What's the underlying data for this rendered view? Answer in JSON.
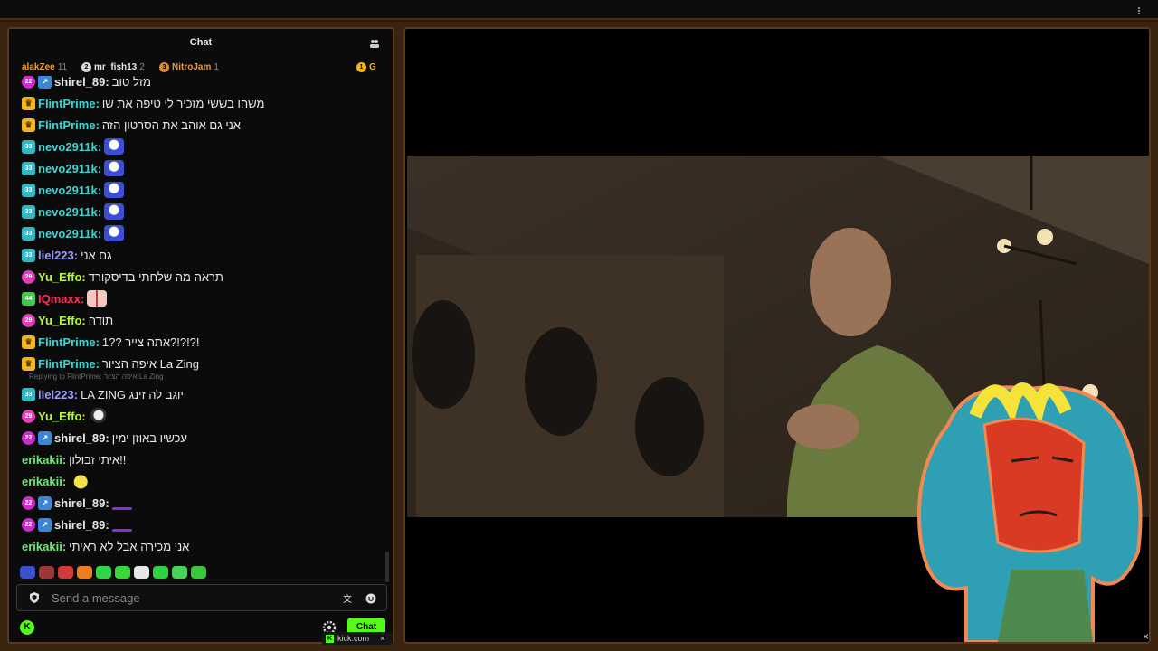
{
  "chat": {
    "title": "Chat",
    "leaderboard": [
      {
        "rank": "",
        "name": "alakZee",
        "count": "11"
      },
      {
        "rank": "2",
        "name": "mr_fish13",
        "count": "2"
      },
      {
        "rank": "3",
        "name": "NitroJam",
        "count": "1"
      },
      {
        "rank": "1",
        "name": "G",
        "count": ""
      }
    ],
    "reply_note": "Replying to FlintPrime: איפה הציור La Zing",
    "messages": [
      {
        "badge": "22",
        "user": "shirel_89:",
        "text": "מזל טוב"
      },
      {
        "badge": "crown",
        "user": "FlintPrime:",
        "text": "משהו בששי מזכיר לי טיפה את שו"
      },
      {
        "badge": "crown",
        "user": "FlintPrime:",
        "text": "אני גם אוהב את הסרטון הזה"
      },
      {
        "badge": "33",
        "user": "nevo2911k:",
        "text": ""
      },
      {
        "badge": "33",
        "user": "nevo2911k:",
        "text": ""
      },
      {
        "badge": "33",
        "user": "nevo2911k:",
        "text": ""
      },
      {
        "badge": "33",
        "user": "nevo2911k:",
        "text": ""
      },
      {
        "badge": "33",
        "user": "nevo2911k:",
        "text": ""
      },
      {
        "badge": "33",
        "user": "liel223:",
        "text": "גם אני"
      },
      {
        "badge": "29",
        "user": "Yu_Effo:",
        "text": "תראה מה שלחתי בדיסקורד"
      },
      {
        "badge": "44",
        "user": "IQmaxx:",
        "text": ""
      },
      {
        "badge": "29",
        "user": "Yu_Effo:",
        "text": "תודה"
      },
      {
        "badge": "crown",
        "user": "FlintPrime:",
        "text": "אתה צייר ??1?!?!?!"
      },
      {
        "badge": "crown",
        "user": "FlintPrime:",
        "text": "איפה הציור La Zing"
      },
      {
        "badge": "33",
        "user": "liel223:",
        "text": "LA ZING יוגב לה זינג"
      },
      {
        "badge": "29",
        "user": "Yu_Effo:",
        "text": ""
      },
      {
        "badge": "22",
        "user": "shirel_89:",
        "text": "עכשיו באוזן ימין"
      },
      {
        "badge": "",
        "user": "erikakii:",
        "text": "איתי זבולון!!"
      },
      {
        "badge": "",
        "user": "erikakii:",
        "text": ""
      },
      {
        "badge": "22",
        "user": "shirel_89:",
        "text": ""
      },
      {
        "badge": "22",
        "user": "shirel_89:",
        "text": ""
      },
      {
        "badge": "",
        "user": "erikakii:",
        "text": "אני מכירה אבל לא ראיתי"
      }
    ],
    "input_placeholder": "Send a message",
    "send_label": "Chat"
  },
  "footer": {
    "site": "kick.com",
    "close": "×"
  },
  "colors": {
    "accent": "#53fc18",
    "border": "#5a3a1c"
  }
}
